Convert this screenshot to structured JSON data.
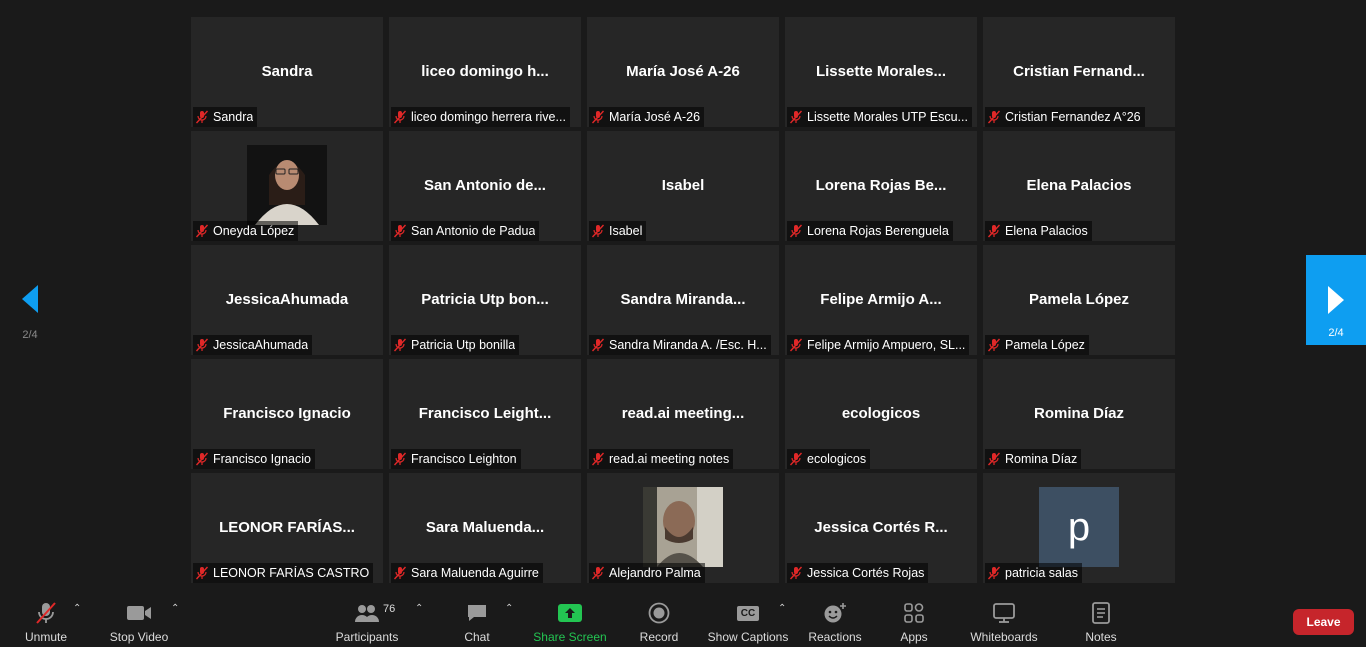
{
  "navigation": {
    "page_indicator_left": "2/4",
    "page_indicator_right": "2/4"
  },
  "participants": [
    {
      "display": "Sandra",
      "label": "Sandra"
    },
    {
      "display": "liceo domingo h...",
      "label": "liceo domingo herrera rive..."
    },
    {
      "display": "María José  A-26",
      "label": "María José  A-26"
    },
    {
      "display": "Lissette Morales...",
      "label": "Lissette Morales UTP Escu..."
    },
    {
      "display": "Cristian  Fernand...",
      "label": "Cristian Fernandez A°26"
    },
    {
      "display": "",
      "label": "Oneyda López",
      "photo": "woman-with-glasses"
    },
    {
      "display": "San Antonio de...",
      "label": "San Antonio de Padua"
    },
    {
      "display": "Isabel",
      "label": "Isabel"
    },
    {
      "display": "Lorena Rojas Be...",
      "label": "Lorena Rojas Berenguela"
    },
    {
      "display": "Elena Palacios",
      "label": "Elena Palacios"
    },
    {
      "display": "JessicaAhumada",
      "label": "JessicaAhumada"
    },
    {
      "display": "Patricia Utp bon...",
      "label": "Patricia Utp bonilla"
    },
    {
      "display": "Sandra  Miranda...",
      "label": "Sandra Miranda A. /Esc. H..."
    },
    {
      "display": "Felipe Armijo A...",
      "label": "Felipe Armijo Ampuero, SL..."
    },
    {
      "display": "Pamela López",
      "label": "Pamela López"
    },
    {
      "display": "Francisco Ignacio",
      "label": "Francisco Ignacio"
    },
    {
      "display": "Francisco  Leight...",
      "label": "Francisco Leighton"
    },
    {
      "display": "read.ai  meeting...",
      "label": "read.ai meeting notes"
    },
    {
      "display": "ecologicos",
      "label": "ecologicos"
    },
    {
      "display": "Romina Díaz",
      "label": "Romina Díaz"
    },
    {
      "display": "LEONOR  FARÍAS...",
      "label": "LEONOR FARÍAS CASTRO"
    },
    {
      "display": "Sara  Maluenda...",
      "label": "Sara Maluenda Aguirre"
    },
    {
      "display": "",
      "label": "Alejandro Palma",
      "photo": "man-with-beard"
    },
    {
      "display": "Jessica Cortés R...",
      "label": "Jessica Cortés Rojas"
    },
    {
      "display": "",
      "label": "patricia salas",
      "avatar_letter": "p"
    }
  ],
  "toolbar": {
    "unmute": "Unmute",
    "stop_video": "Stop Video",
    "participants": "Participants",
    "participant_count": "76",
    "chat": "Chat",
    "share_screen": "Share Screen",
    "record": "Record",
    "show_captions": "Show Captions",
    "captions_icon_text": "CC",
    "reactions": "Reactions",
    "apps": "Apps",
    "whiteboards": "Whiteboards",
    "notes": "Notes",
    "leave": "Leave"
  },
  "colors": {
    "accent": "#0e9ef1",
    "share_green": "#23c552",
    "leave_red": "#c6252b",
    "muted_red": "#e02828"
  }
}
